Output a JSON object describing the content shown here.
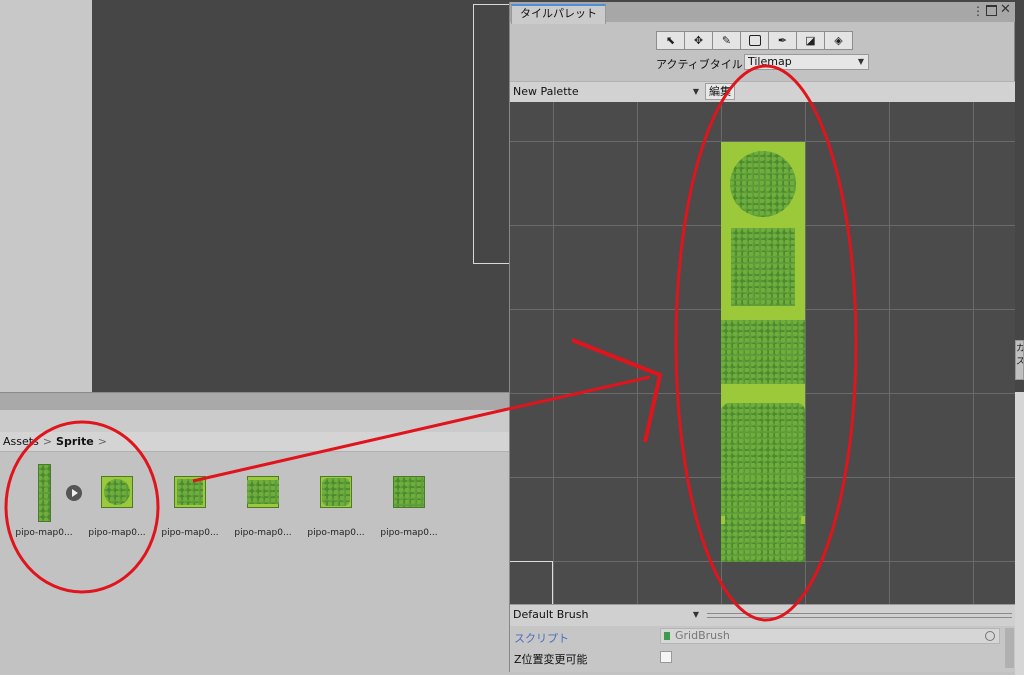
{
  "project": {
    "breadcrumb": [
      "Assets",
      "Sprite"
    ],
    "assets": [
      {
        "label": "pipo-map0...",
        "kind": "sheet"
      },
      {
        "label": "pipo-map0...",
        "kind": "circle"
      },
      {
        "label": "pipo-map0...",
        "kind": "square"
      },
      {
        "label": "pipo-map0...",
        "kind": "wide"
      },
      {
        "label": "pipo-map0...",
        "kind": "round-square"
      },
      {
        "label": "pipo-map0...",
        "kind": "plain"
      }
    ]
  },
  "palette_window": {
    "tab_title": "タイルパレット",
    "tools": [
      "select-icon",
      "move-icon",
      "brush-icon",
      "box-fill-icon",
      "picker-icon",
      "eraser-icon",
      "fill-icon"
    ],
    "active_tilemap_label": "アクティブタイルマッ",
    "active_tilemap_value": "Tilemap",
    "palette_value": "New Palette",
    "edit_label": "編集",
    "brush_value": "Default Brush",
    "script_label": "スクリプト",
    "script_value": "GridBrush",
    "zpos_label": "Z位置変更可能"
  },
  "right_stub_text": "カス",
  "colors": {
    "annotation": "#e0141c",
    "tab_accent": "#4a90d9",
    "grass_light": "#9cc93a",
    "grass_dark": "#5a9a36"
  }
}
